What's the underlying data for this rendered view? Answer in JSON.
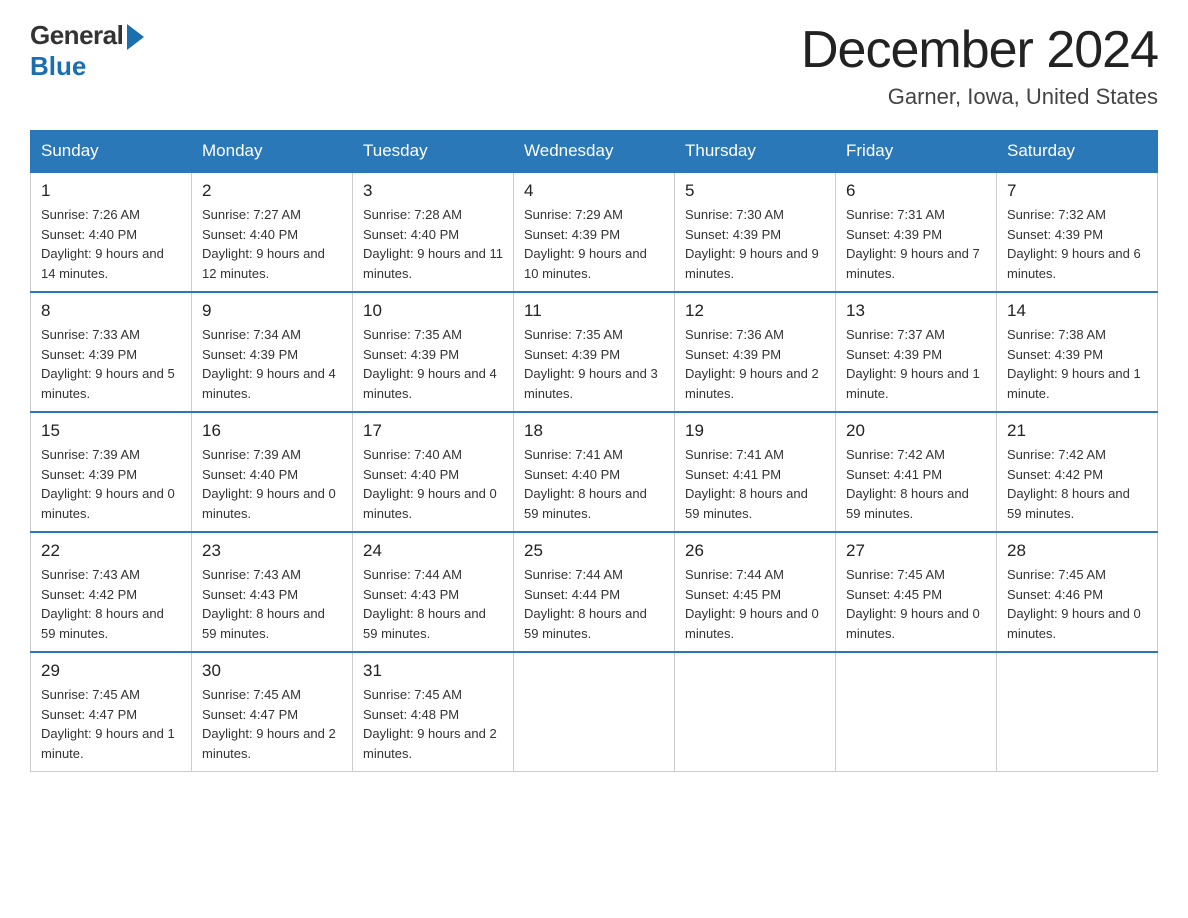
{
  "logo": {
    "general": "General",
    "blue": "Blue"
  },
  "header": {
    "month": "December 2024",
    "location": "Garner, Iowa, United States"
  },
  "days_of_week": [
    "Sunday",
    "Monday",
    "Tuesday",
    "Wednesday",
    "Thursday",
    "Friday",
    "Saturday"
  ],
  "weeks": [
    [
      {
        "day": 1,
        "sunrise": "7:26 AM",
        "sunset": "4:40 PM",
        "daylight": "9 hours and 14 minutes."
      },
      {
        "day": 2,
        "sunrise": "7:27 AM",
        "sunset": "4:40 PM",
        "daylight": "9 hours and 12 minutes."
      },
      {
        "day": 3,
        "sunrise": "7:28 AM",
        "sunset": "4:40 PM",
        "daylight": "9 hours and 11 minutes."
      },
      {
        "day": 4,
        "sunrise": "7:29 AM",
        "sunset": "4:39 PM",
        "daylight": "9 hours and 10 minutes."
      },
      {
        "day": 5,
        "sunrise": "7:30 AM",
        "sunset": "4:39 PM",
        "daylight": "9 hours and 9 minutes."
      },
      {
        "day": 6,
        "sunrise": "7:31 AM",
        "sunset": "4:39 PM",
        "daylight": "9 hours and 7 minutes."
      },
      {
        "day": 7,
        "sunrise": "7:32 AM",
        "sunset": "4:39 PM",
        "daylight": "9 hours and 6 minutes."
      }
    ],
    [
      {
        "day": 8,
        "sunrise": "7:33 AM",
        "sunset": "4:39 PM",
        "daylight": "9 hours and 5 minutes."
      },
      {
        "day": 9,
        "sunrise": "7:34 AM",
        "sunset": "4:39 PM",
        "daylight": "9 hours and 4 minutes."
      },
      {
        "day": 10,
        "sunrise": "7:35 AM",
        "sunset": "4:39 PM",
        "daylight": "9 hours and 4 minutes."
      },
      {
        "day": 11,
        "sunrise": "7:35 AM",
        "sunset": "4:39 PM",
        "daylight": "9 hours and 3 minutes."
      },
      {
        "day": 12,
        "sunrise": "7:36 AM",
        "sunset": "4:39 PM",
        "daylight": "9 hours and 2 minutes."
      },
      {
        "day": 13,
        "sunrise": "7:37 AM",
        "sunset": "4:39 PM",
        "daylight": "9 hours and 1 minute."
      },
      {
        "day": 14,
        "sunrise": "7:38 AM",
        "sunset": "4:39 PM",
        "daylight": "9 hours and 1 minute."
      }
    ],
    [
      {
        "day": 15,
        "sunrise": "7:39 AM",
        "sunset": "4:39 PM",
        "daylight": "9 hours and 0 minutes."
      },
      {
        "day": 16,
        "sunrise": "7:39 AM",
        "sunset": "4:40 PM",
        "daylight": "9 hours and 0 minutes."
      },
      {
        "day": 17,
        "sunrise": "7:40 AM",
        "sunset": "4:40 PM",
        "daylight": "9 hours and 0 minutes."
      },
      {
        "day": 18,
        "sunrise": "7:41 AM",
        "sunset": "4:40 PM",
        "daylight": "8 hours and 59 minutes."
      },
      {
        "day": 19,
        "sunrise": "7:41 AM",
        "sunset": "4:41 PM",
        "daylight": "8 hours and 59 minutes."
      },
      {
        "day": 20,
        "sunrise": "7:42 AM",
        "sunset": "4:41 PM",
        "daylight": "8 hours and 59 minutes."
      },
      {
        "day": 21,
        "sunrise": "7:42 AM",
        "sunset": "4:42 PM",
        "daylight": "8 hours and 59 minutes."
      }
    ],
    [
      {
        "day": 22,
        "sunrise": "7:43 AM",
        "sunset": "4:42 PM",
        "daylight": "8 hours and 59 minutes."
      },
      {
        "day": 23,
        "sunrise": "7:43 AM",
        "sunset": "4:43 PM",
        "daylight": "8 hours and 59 minutes."
      },
      {
        "day": 24,
        "sunrise": "7:44 AM",
        "sunset": "4:43 PM",
        "daylight": "8 hours and 59 minutes."
      },
      {
        "day": 25,
        "sunrise": "7:44 AM",
        "sunset": "4:44 PM",
        "daylight": "8 hours and 59 minutes."
      },
      {
        "day": 26,
        "sunrise": "7:44 AM",
        "sunset": "4:45 PM",
        "daylight": "9 hours and 0 minutes."
      },
      {
        "day": 27,
        "sunrise": "7:45 AM",
        "sunset": "4:45 PM",
        "daylight": "9 hours and 0 minutes."
      },
      {
        "day": 28,
        "sunrise": "7:45 AM",
        "sunset": "4:46 PM",
        "daylight": "9 hours and 0 minutes."
      }
    ],
    [
      {
        "day": 29,
        "sunrise": "7:45 AM",
        "sunset": "4:47 PM",
        "daylight": "9 hours and 1 minute."
      },
      {
        "day": 30,
        "sunrise": "7:45 AM",
        "sunset": "4:47 PM",
        "daylight": "9 hours and 2 minutes."
      },
      {
        "day": 31,
        "sunrise": "7:45 AM",
        "sunset": "4:48 PM",
        "daylight": "9 hours and 2 minutes."
      },
      null,
      null,
      null,
      null
    ]
  ]
}
